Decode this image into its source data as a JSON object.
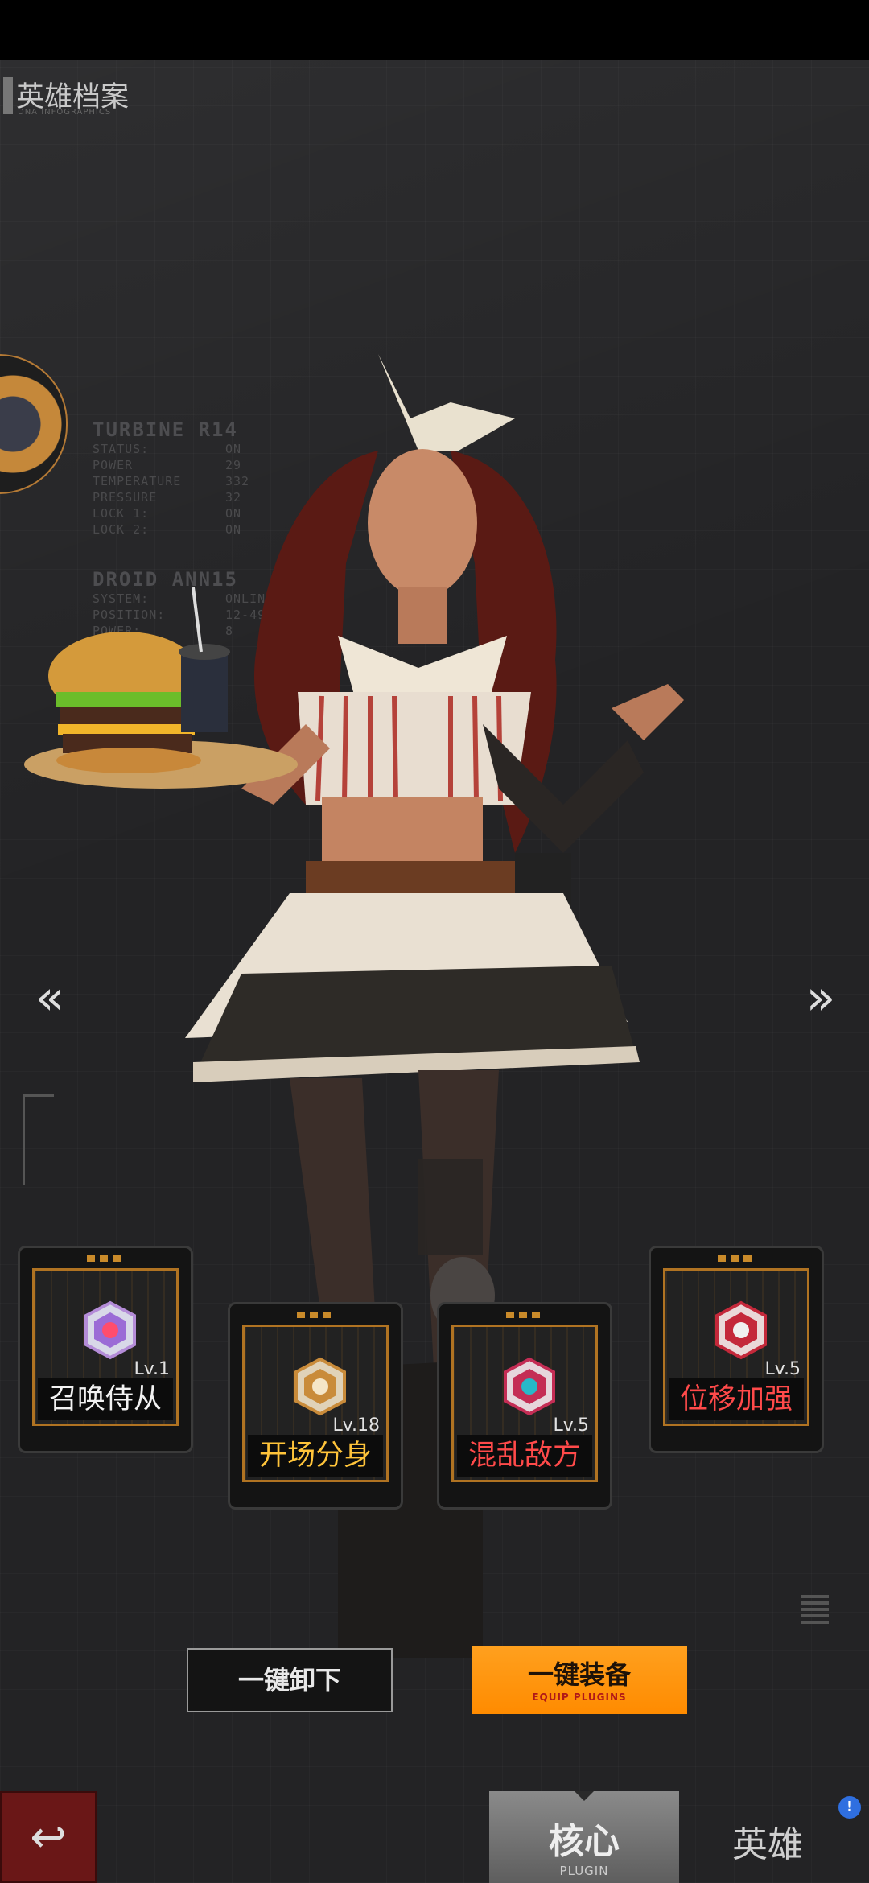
{
  "header": {
    "title": "英雄档案",
    "subtitle": "DNA INFOGRAPHICS"
  },
  "info_panels": [
    {
      "heading": "TURBINE R14",
      "rows": [
        {
          "key": "STATUS:",
          "value": "ON"
        },
        {
          "key": "POWER",
          "value": "29"
        },
        {
          "key": "TEMPERATURE",
          "value": "332"
        },
        {
          "key": "PRESSURE",
          "value": "32"
        },
        {
          "key": "LOCK 1:",
          "value": "ON"
        },
        {
          "key": "LOCK 2:",
          "value": "ON"
        }
      ]
    },
    {
      "heading": "DROID ANN15",
      "rows": [
        {
          "key": "SYSTEM:",
          "value": "ONLINE"
        },
        {
          "key": "POSITION:",
          "value": "12-49"
        },
        {
          "key": "POWER:",
          "value": "8"
        }
      ]
    }
  ],
  "navigation": {
    "prev": "«",
    "next": "»"
  },
  "plugins": [
    {
      "name": "召唤侍从",
      "level": "Lv.1",
      "name_color": "#f2f2f2",
      "badge_color": "#9b6bd6"
    },
    {
      "name": "开场分身",
      "level": "Lv.18",
      "name_color": "#ffc43a",
      "badge_color": "#c98b3a"
    },
    {
      "name": "混乱敌方",
      "level": "Lv.5",
      "name_color": "#ff4a4a",
      "badge_color": "#c42d55"
    },
    {
      "name": "位移加强",
      "level": "Lv.5",
      "name_color": "#ff4a4a",
      "badge_color": "#c4283a"
    }
  ],
  "buttons": {
    "unequip": "一键卸下",
    "equip": "一键装备",
    "equip_sub": "EQUIP PLUGINS",
    "back_icon": "↩"
  },
  "tabs": {
    "core": "核心",
    "core_sub": "PLUGIN",
    "hero": "英雄",
    "hero_badge": "!"
  },
  "colors": {
    "accent": "#ff9500",
    "card_border": "#b07322",
    "back_button": "#6a1717"
  }
}
